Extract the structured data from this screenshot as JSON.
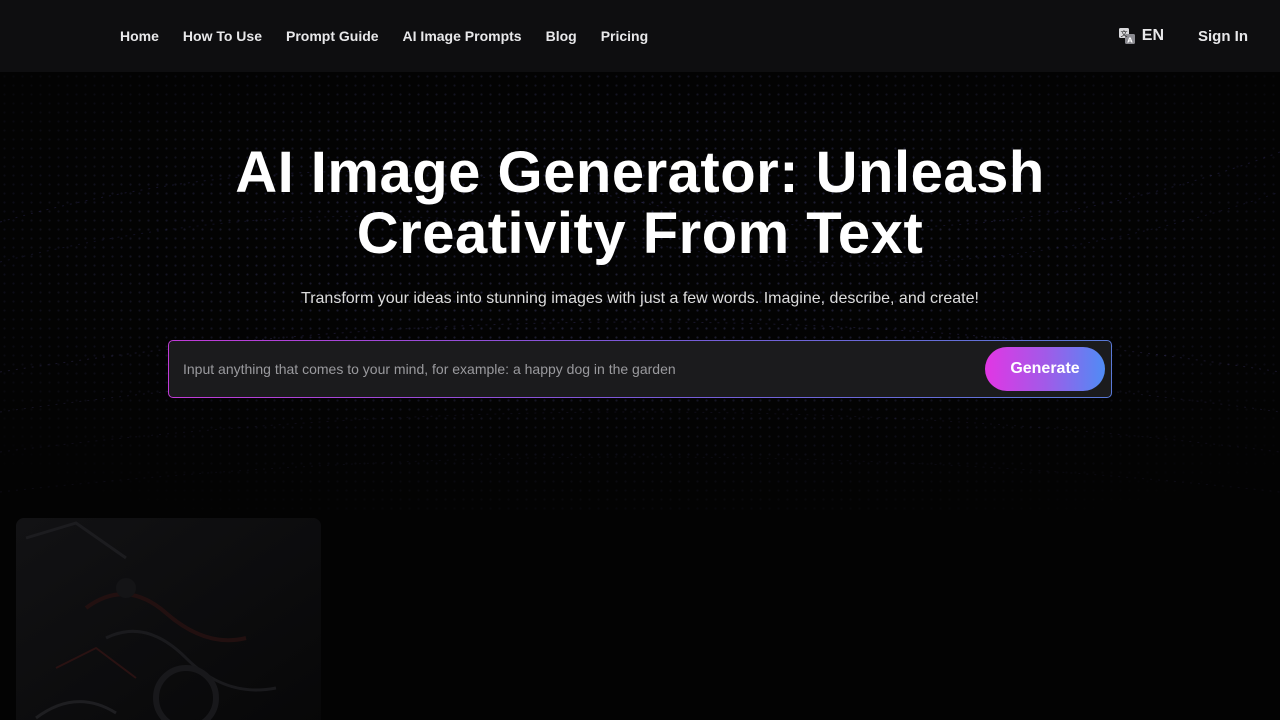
{
  "nav": {
    "items": [
      {
        "label": "Home"
      },
      {
        "label": "How To Use"
      },
      {
        "label": "Prompt Guide"
      },
      {
        "label": "AI Image Prompts"
      },
      {
        "label": "Blog"
      },
      {
        "label": "Pricing"
      }
    ]
  },
  "header": {
    "language": "EN",
    "language_icon": "translate-icon",
    "sign_in": "Sign In"
  },
  "hero": {
    "title": "AI Image Generator: Unleash Creativity From Text",
    "subtitle": "Transform your ideas into stunning images with just a few words. Imagine, describe, and create!"
  },
  "prompt": {
    "value": "",
    "placeholder": "Input anything that comes to your mind, for example: a happy dog in the garden",
    "button_label": "Generate"
  },
  "colors": {
    "background": "#030303",
    "header_bg": "#0e0e10",
    "gradient_start": "#e236e4",
    "gradient_end": "#4f8cf5"
  }
}
